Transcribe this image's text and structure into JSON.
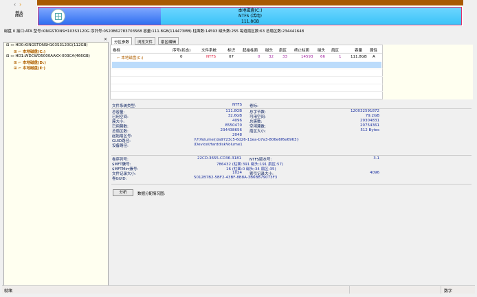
{
  "nav": {
    "back": "‹",
    "forward": "›",
    "disk_type": "基本",
    "disk_sub": "MBR"
  },
  "disk_map": {
    "name": "本地磁盘(C:)",
    "fs": "NTFS (活动)",
    "size": "111.8GB",
    "colors": {
      "partition": "#3cc3f8",
      "unallocated": "#a85a00",
      "border": "#e0306a"
    }
  },
  "disk_info": "磁盘 0 接口:ATA  型号:KINGSTONSH103S3120G  序列号:0520B62783703568  容量:111.8GB(114473MB)  柱面数:14593  磁头数:255  每道扇区数:63  总扇区数:234441648",
  "tree": [
    {
      "label": "HD0:KINGSTONSH103S3120G(112GB)",
      "type": "disk"
    },
    {
      "label": "本地磁盘(C:)",
      "type": "part"
    },
    {
      "label": "HD1:WDCWD5000AAKX-003CA(466GB)",
      "type": "disk"
    },
    {
      "label": "本地磁盘(D:)",
      "type": "part"
    },
    {
      "label": "本地磁盘(E:)",
      "type": "part"
    }
  ],
  "tabs": [
    "分区参数",
    "浏览文件",
    "扇区编辑"
  ],
  "table": {
    "headers": [
      "卷标",
      "序号(状态)",
      "文件系统",
      "标识",
      "起始柱面",
      "磁头",
      "扇区",
      "终止柱面",
      "磁头",
      "扇区",
      "容量",
      "属性"
    ],
    "rows": [
      [
        "本地磁盘(C:)",
        "0",
        "NTFS",
        "07",
        "0",
        "32",
        "33",
        "14593",
        "66",
        "1",
        "111.8GB",
        "A"
      ]
    ]
  },
  "details": {
    "fs_type_label": "文件系统类型:",
    "fs_type": "NTFS",
    "vol_label": "卷标:",
    "left": [
      [
        "总容量:",
        "111.8GB"
      ],
      [
        "已用空间:",
        "32.6GB"
      ],
      [
        "簇大小:",
        "4096"
      ],
      [
        "已用簇数:",
        "8550470"
      ],
      [
        "总扇区数:",
        "234438656"
      ],
      [
        "起始扇区号:",
        "2048"
      ]
    ],
    "right": [
      [
        "总字节数:",
        "120032591872"
      ],
      [
        "可用空间:",
        "79.2GB"
      ],
      [
        "总簇数:",
        "29304831"
      ],
      [
        "空闲簇数:",
        "20754361"
      ],
      [
        "扇区大小:",
        "512 Bytes"
      ]
    ],
    "guid_path_label": "GUID路径:",
    "guid_path": "\\\\?\\Volume{da9723c5-6d26-11ea-b7a3-806e6f6e6963}",
    "device_path_label": "设备路径:",
    "device_path": "\\Device\\HarddiskVolume1",
    "serial_label": "卷序列号:",
    "serial": "22CD-3655-CD36-3181",
    "ntfs_ver_label": "NTFS版本号:",
    "ntfs_ver": "3.1",
    "mft_label": "$MFT簇号:",
    "mft": "786432 (柱面:391 磁头:191 扇区:57)",
    "mftmirr_label": "$MFTMirr簇号:",
    "mftmirr": "16 (柱面:0 磁头:34 扇区:35)",
    "frs_label": "文件记录大小:",
    "frs": "1024",
    "irs_label": "索引记录大小:",
    "irs": "4096",
    "guid_label": "卷GUID:",
    "guid": "5012B7B2-5BF2-43BF-8B8A-3B6BB79073F3"
  },
  "analyze_button": "分析",
  "distribution_label": "数据分配情况图:",
  "status": {
    "left": "就绪",
    "right": "数字"
  }
}
